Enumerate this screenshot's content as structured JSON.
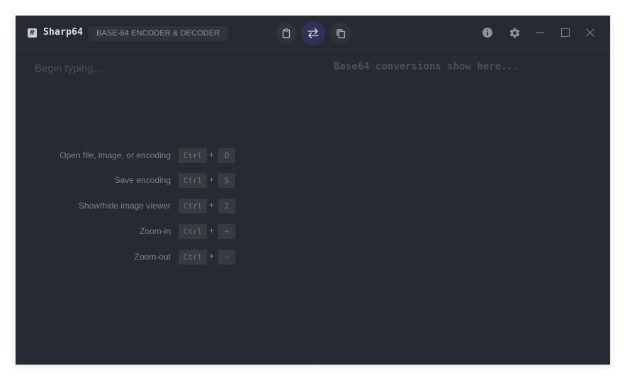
{
  "app": {
    "title": "Sharp64",
    "icon": "hash-icon",
    "subtitle": "BASE-64 ENCODER & DECODER"
  },
  "toolbar": {
    "paste": {
      "icon": "clipboard-icon"
    },
    "swap": {
      "icon": "swap-arrows-icon",
      "active": true
    },
    "copy": {
      "icon": "copy-icon"
    }
  },
  "window_controls": {
    "info": {
      "icon": "info-icon"
    },
    "settings": {
      "icon": "gear-icon"
    },
    "minimize": {
      "icon": "minimize-icon"
    },
    "maximize": {
      "icon": "maximize-icon"
    },
    "close": {
      "icon": "close-icon"
    }
  },
  "input": {
    "placeholder": "Begin typing..."
  },
  "output": {
    "placeholder": "Base64 conversions show here..."
  },
  "shortcuts": [
    {
      "label": "Open file, image, or encoding",
      "modifier": "Ctrl",
      "plus": "+",
      "key": "O"
    },
    {
      "label": "Save encoding",
      "modifier": "Ctrl",
      "plus": "+",
      "key": "S"
    },
    {
      "label": "Show/hide image viewer",
      "modifier": "Ctrl",
      "plus": "+",
      "key": "I"
    },
    {
      "label": "Zoom-in",
      "modifier": "Ctrl",
      "plus": "+",
      "key": "+"
    },
    {
      "label": "Zoom-out",
      "modifier": "Ctrl",
      "plus": "+",
      "key": "−"
    }
  ],
  "colors": {
    "background": "#262a33",
    "accent_active": "#2f3359",
    "text_muted": "#7b808a"
  }
}
